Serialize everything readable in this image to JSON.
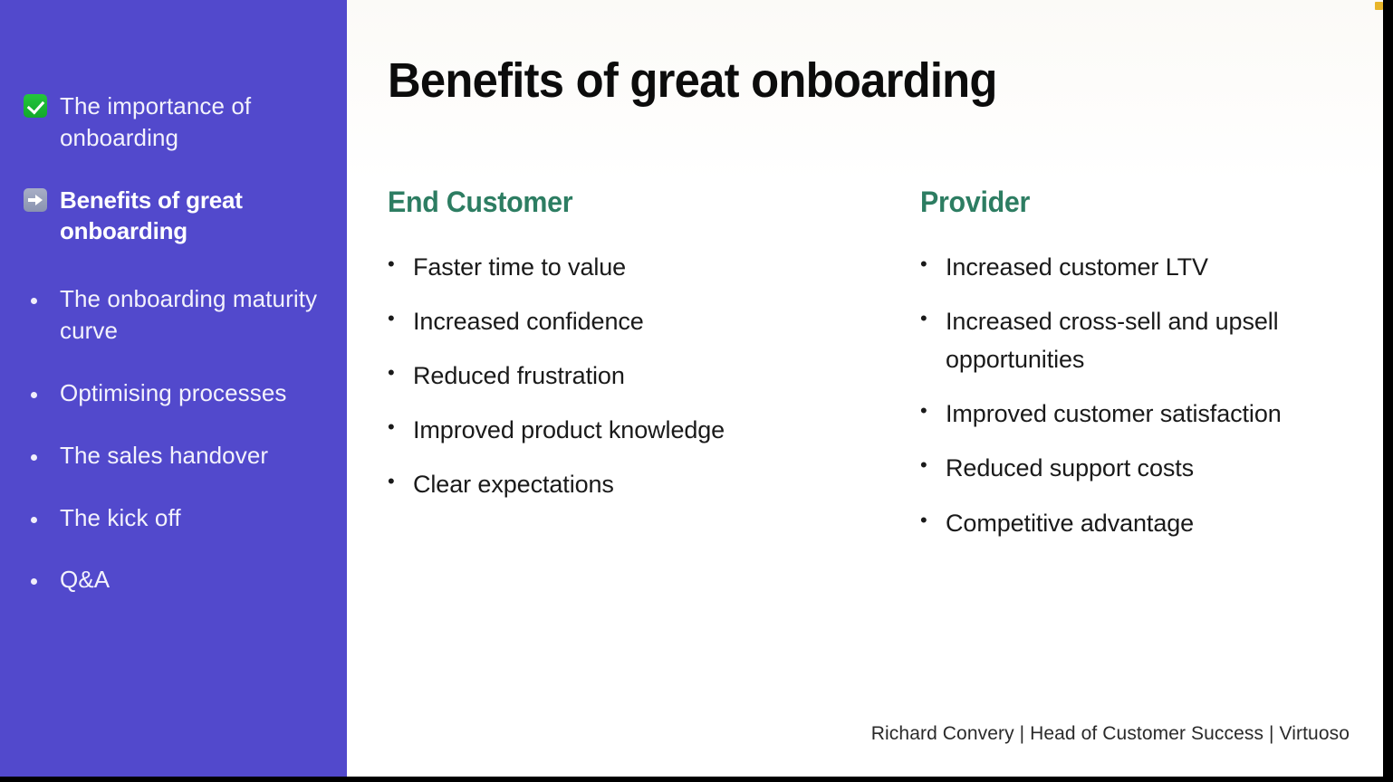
{
  "slide": {
    "title": "Benefits of great onboarding",
    "background_color": "#ffffff",
    "accent_green": "#2d7d62",
    "sidebar_color": "#5249cc"
  },
  "sidebar": {
    "items": [
      {
        "label": "The importance of onboarding",
        "marker": "white-heavy-check-mark-icon",
        "state": "done"
      },
      {
        "label": "Benefits of great onboarding",
        "marker": "right-arrow-icon",
        "state": "active"
      },
      {
        "label": "The onboarding maturity curve",
        "marker": "bullet-dot-icon",
        "state": "upcoming"
      },
      {
        "label": "Optimising processes",
        "marker": "bullet-dot-icon",
        "state": "upcoming"
      },
      {
        "label": "The sales handover",
        "marker": "bullet-dot-icon",
        "state": "upcoming"
      },
      {
        "label": "The kick off",
        "marker": "bullet-dot-icon",
        "state": "upcoming"
      },
      {
        "label": "Q&A",
        "marker": "bullet-dot-icon",
        "state": "upcoming"
      }
    ]
  },
  "columns": [
    {
      "heading": "End Customer",
      "bullets": [
        "Faster time to value",
        "Increased confidence",
        "Reduced frustration",
        "Improved product knowledge",
        "Clear expectations"
      ]
    },
    {
      "heading": "Provider",
      "bullets": [
        "Increased customer LTV",
        "Increased cross-sell and upsell opportunities",
        "Improved customer satisfaction",
        "Reduced support costs",
        "Competitive advantage"
      ]
    }
  ],
  "footer": {
    "credit": "Richard Convery | Head of Customer Success | Virtuoso"
  },
  "bullet_glyph": "•"
}
